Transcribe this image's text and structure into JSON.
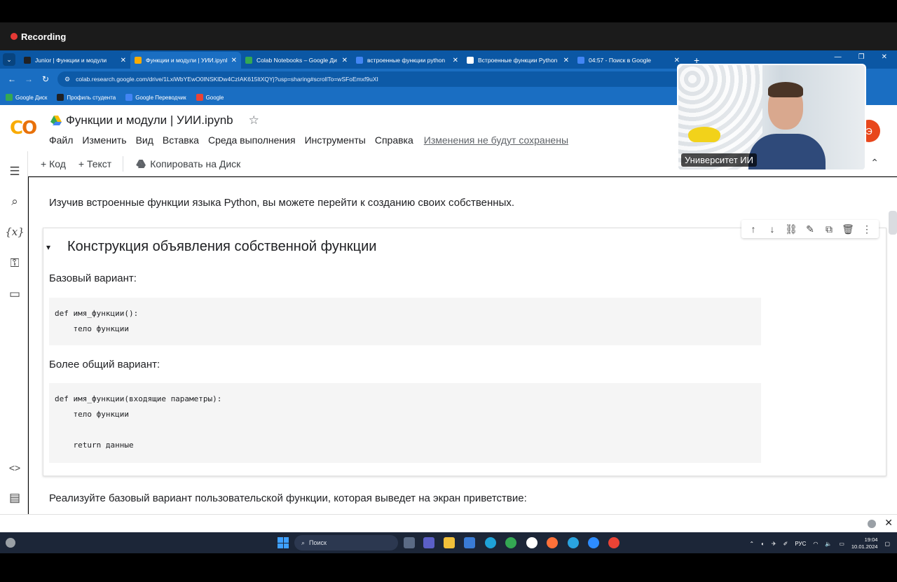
{
  "recording": {
    "label": "Recording"
  },
  "tabs": [
    {
      "title": "Junior | Функции и модули",
      "color": "#202124",
      "active": false
    },
    {
      "title": "Функции и модули | УИИ.ipynb",
      "color": "#f9ab00",
      "active": true
    },
    {
      "title": "Colab Notebooks – Google Ди",
      "color": "#34a853",
      "active": false
    },
    {
      "title": "встроенные функции python",
      "color": "#4285f4",
      "active": false
    },
    {
      "title": "Встроенные функции Python",
      "color": "#ffffff",
      "active": false
    },
    {
      "title": "04:57 - Поиск в Google",
      "color": "#4285f4",
      "active": false
    }
  ],
  "address": {
    "url": "colab.research.google.com/drive/1LxiWbYEwO0INSKlDw4CzIAK615ltXQYj?usp=sharing#scrollTo=wSFoEmxf9uXI"
  },
  "bookmarks": [
    {
      "label": "Google Диск",
      "color": "#34a853"
    },
    {
      "label": "Профиль студента",
      "color": "#202124"
    },
    {
      "label": "Google Переводчик",
      "color": "#4285f4"
    },
    {
      "label": "Google",
      "color": "#ea4335"
    }
  ],
  "notebook": {
    "logo": "CO",
    "title": "Функции и модули | УИИ.ipynb",
    "menu": [
      "Файл",
      "Изменить",
      "Вид",
      "Вставка",
      "Среда выполнения",
      "Инструменты",
      "Справка"
    ],
    "unsaved": "Изменения не будут сохранены"
  },
  "toolbar": {
    "code": "+ Код",
    "text": "+ Текст",
    "copy": "Копировать на Диск"
  },
  "content": {
    "intro": "Изучив встроенные функции языка Python, вы можете перейти к созданию своих собственных.",
    "heading": "Конструкция объявления собственной функции",
    "basic_label": "Базовый вариант:",
    "basic_code": [
      "def имя_функции():",
      "    тело функции"
    ],
    "general_label": "Более общий вариант:",
    "general_code": [
      "def имя_функции(входящие параметры):",
      "    тело функции",
      "",
      "    return данные"
    ],
    "next": "Реализуйте базовый вариант пользовательской функции, которая выведет на экран приветствие:"
  },
  "webcam": {
    "label": "Университет ИИ"
  },
  "taskbar": {
    "search": "Поиск",
    "lang": "РУС",
    "time": "19:04",
    "date": "10.01.2024"
  }
}
